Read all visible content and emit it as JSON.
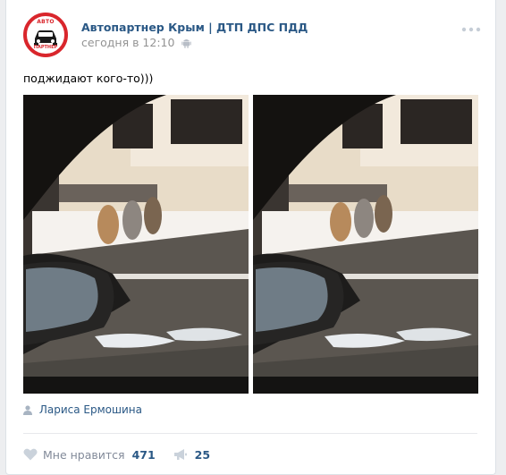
{
  "post": {
    "author_name": "Автопартнер Крым | ДТП ДПС ПДД",
    "time": "сегодня в 12:10",
    "text": "поджидают кого-то)))",
    "avatar": {
      "top_text": "АВТО",
      "bottom_text": "ПАРТНЕР",
      "color": "#d9262c"
    },
    "photos": [
      {
        "description": "cats-waiting-photo"
      },
      {
        "description": "cats-waiting-photo"
      }
    ],
    "photo_author": "Лариса Ермошина",
    "likes": {
      "label": "Мне нравится",
      "count": "471"
    },
    "shares": {
      "count": "25"
    }
  },
  "colors": {
    "link": "#2a5885",
    "muted": "#939393",
    "action": "#828a99",
    "background": "#edeef0"
  }
}
